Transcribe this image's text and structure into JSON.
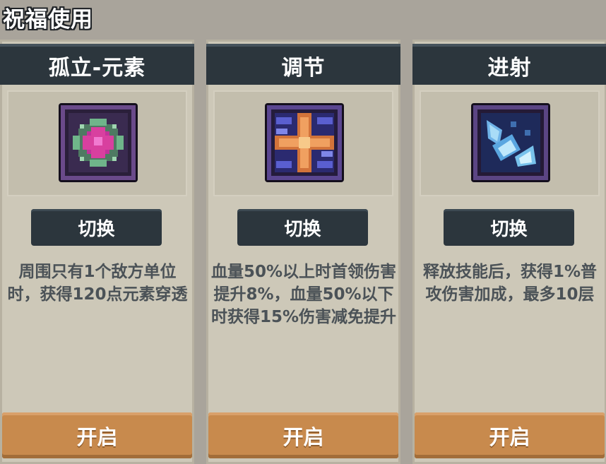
{
  "page": {
    "title": "祝福使用"
  },
  "cards": [
    {
      "name": "孤立-元素",
      "icon": "pink-gem-icon",
      "switch_label": "切换",
      "description": "周围只有1个敌方单位时，获得120点元素穿透",
      "open_label": "开启"
    },
    {
      "name": "调节",
      "icon": "orange-cross-icon",
      "switch_label": "切换",
      "description": "血量50%以上时首领伤害提升8%，血量50%以下时获得15%伤害减免提升",
      "open_label": "开启"
    },
    {
      "name": "进射",
      "icon": "blue-shards-icon",
      "switch_label": "切换",
      "description": "释放技能后，获得1%普攻伤害加成，最多10层",
      "open_label": "开启"
    }
  ],
  "colors": {
    "background": "#a9a49b",
    "card": "#cdc8b8",
    "header": "#2c363d",
    "button_dark": "#2c363d",
    "button_orange": "#c88a4d",
    "description_text": "#4b5257"
  }
}
